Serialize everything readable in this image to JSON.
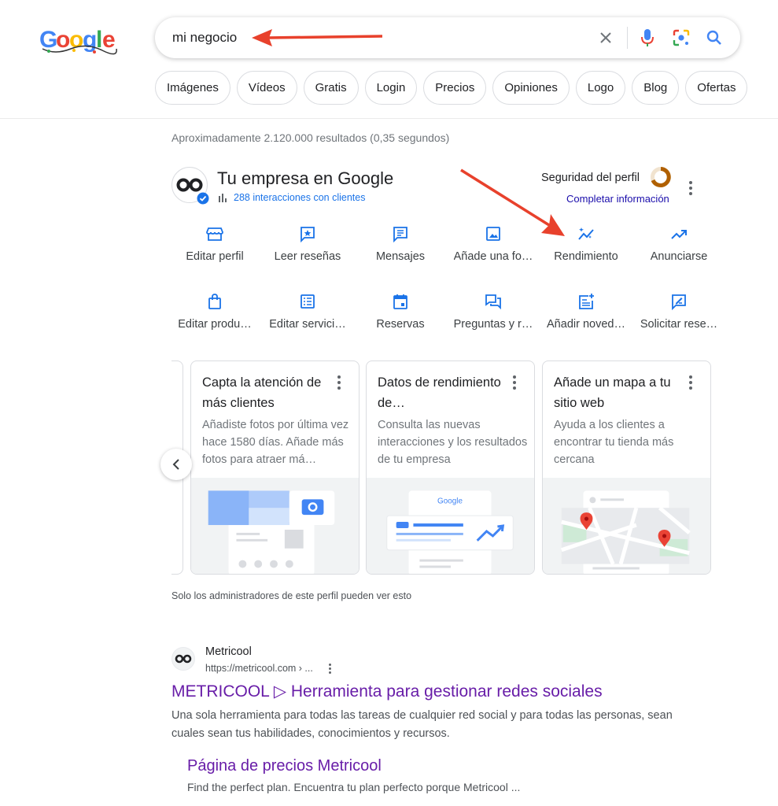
{
  "search": {
    "query": "mi negocio"
  },
  "chips": [
    "Imágenes",
    "Vídeos",
    "Gratis",
    "Login",
    "Precios",
    "Opiniones",
    "Logo",
    "Blog",
    "Ofertas"
  ],
  "results_count": "Aproximadamente 2.120.000 resultados (0,35 segundos)",
  "business": {
    "title": "Tu empresa en Google",
    "interactions": "288 interacciones con clientes",
    "profile_security": "Seguridad del perfil",
    "complete_info": "Completar información",
    "actions_row1": [
      {
        "label": "Editar perfil",
        "icon": "storefront-icon"
      },
      {
        "label": "Leer reseñas",
        "icon": "review-icon"
      },
      {
        "label": "Mensajes",
        "icon": "message-icon"
      },
      {
        "label": "Añade una fo…",
        "icon": "photo-icon"
      },
      {
        "label": "Rendimiento",
        "icon": "performance-icon"
      },
      {
        "label": "Anunciarse",
        "icon": "trending-up-icon"
      }
    ],
    "actions_row2": [
      {
        "label": "Editar produ…",
        "icon": "shopping-bag-icon"
      },
      {
        "label": "Editar servici…",
        "icon": "list-icon"
      },
      {
        "label": "Reservas",
        "icon": "calendar-icon"
      },
      {
        "label": "Preguntas y r…",
        "icon": "qa-icon"
      },
      {
        "label": "Añadir noved…",
        "icon": "post-add-icon"
      },
      {
        "label": "Solicitar rese…",
        "icon": "rate-review-icon"
      }
    ]
  },
  "cards": [
    {
      "title": "Capta la atención de más clientes",
      "text": "Añadiste fotos por última vez hace 1580 días. Añade más fotos para atraer má…"
    },
    {
      "title": "Datos de rendimiento de…",
      "text": "Consulta las nuevas interacciones y los resultados de tu empresa",
      "art_brand": "Google"
    },
    {
      "title": "Añade un mapa a tu sitio web",
      "text": "Ayuda a los clientes a encontrar tu tienda más cercana"
    }
  ],
  "admin_note": "Solo los administradores de este perfil pueden ver esto",
  "result": {
    "site_name": "Metricool",
    "url": "https://metricool.com › ...",
    "title": "METRICOOL ▷ Herramienta para gestionar redes sociales",
    "snippet": "Una sola herramienta para todas las tareas de cualquier red social y para todas las personas, sean cuales sean tus habilidades, conocimientos y recursos.",
    "sitelink_title": "Página de precios Metricool",
    "sitelink_snippet": "Find the perfect plan. Encuentra tu plan perfecto porque Metricool ..."
  },
  "colors": {
    "link_visited": "#681da8",
    "accent_blue": "#1a73e8",
    "annotation_arrow": "#e8412c"
  }
}
